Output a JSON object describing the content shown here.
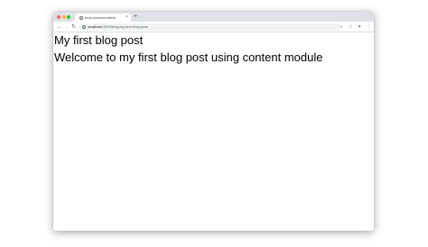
{
  "browser": {
    "tab": {
      "title": "nuxt-content-article",
      "close_glyph": "×"
    },
    "new_tab_glyph": "+",
    "address": {
      "host": "localhost",
      "path": ":3000/blog/my-first-blog-post"
    },
    "icons": [
      "back-icon",
      "forward-icon",
      "reload-icon",
      "info-icon",
      "search-icon",
      "star-icon",
      "extensions-icon",
      "menu-icon"
    ]
  },
  "page": {
    "title": "My first blog post",
    "body": "Welcome to my first blog post using content module"
  },
  "colors": {
    "tabstrip": "#dee1e6",
    "close": "#ff5f57",
    "minimize": "#febc2e",
    "maximize": "#28c840"
  }
}
